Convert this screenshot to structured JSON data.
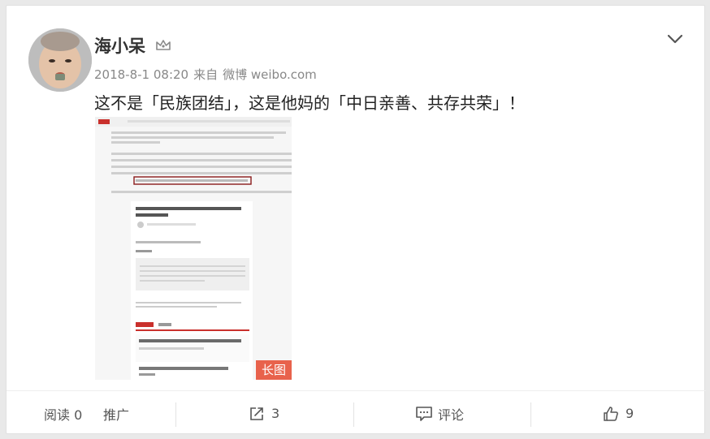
{
  "post": {
    "username": "海小呆",
    "timestamp": "2018-8-1 08:20",
    "source_prefix": "来自",
    "source": "微博 weibo.com",
    "text": "这不是「民族团结」，这是他妈的「中日亲善、共存共荣」！",
    "image_badge": "长图",
    "avatar_icon": "avatar-photo",
    "verified_icon": "crown-icon"
  },
  "actions": {
    "read_label": "阅读 0",
    "promote_label": "推广",
    "repost_count": "3",
    "comment_label": "评论",
    "like_count": "9"
  },
  "colors": {
    "badge": "#e8624c",
    "text": "#222222",
    "meta": "#888888"
  }
}
